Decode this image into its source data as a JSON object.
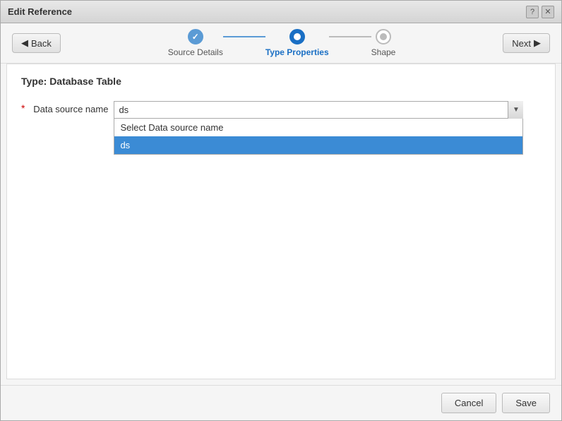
{
  "title_bar": {
    "title": "Edit Reference",
    "help_icon": "?",
    "close_icon": "✕"
  },
  "toolbar": {
    "back_label": "Back",
    "next_label": "Next"
  },
  "stepper": {
    "steps": [
      {
        "id": "source-details",
        "label": "Source Details",
        "state": "completed"
      },
      {
        "id": "type-properties",
        "label": "Type Properties",
        "state": "active"
      },
      {
        "id": "shape",
        "label": "Shape",
        "state": "inactive"
      }
    ]
  },
  "content": {
    "type_header": "Type:  Database Table",
    "form": {
      "required_symbol": "*",
      "field_label": "Data source name",
      "selected_value": "ds",
      "dropdown_options": [
        {
          "label": "Select Data source name",
          "value": "",
          "selected": false
        },
        {
          "label": "ds",
          "value": "ds",
          "selected": true
        }
      ]
    }
  },
  "footer": {
    "cancel_label": "Cancel",
    "save_label": "Save"
  }
}
